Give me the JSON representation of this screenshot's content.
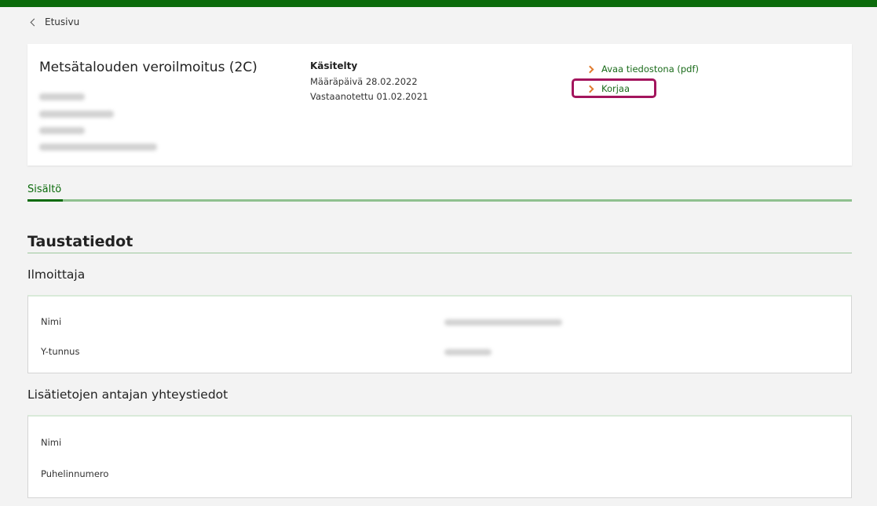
{
  "nav": {
    "back_label": "Etusivu"
  },
  "document": {
    "title": "Metsätalouden veroilmoitus (2C)",
    "status": "Käsitelty",
    "due": "Määräpäivä 28.02.2022",
    "received": "Vastaanotettu 01.02.2021",
    "actions": {
      "open_pdf": "Avaa tiedostona (pdf)",
      "correct": "Korjaa"
    }
  },
  "tabs": {
    "content": "Sisältö"
  },
  "section": {
    "title": "Taustatiedot",
    "filer": {
      "title": "Ilmoittaja",
      "name_label": "Nimi",
      "ytunnus_label": "Y-tunnus"
    },
    "contact": {
      "title": "Lisätietojen antajan yhteystiedot",
      "name_label": "Nimi",
      "phone_label": "Puhelinnumero"
    }
  },
  "colors": {
    "brand_green": "#0b6b0b",
    "highlight": "#a3155d",
    "link_arrow": "#e07b2e"
  }
}
